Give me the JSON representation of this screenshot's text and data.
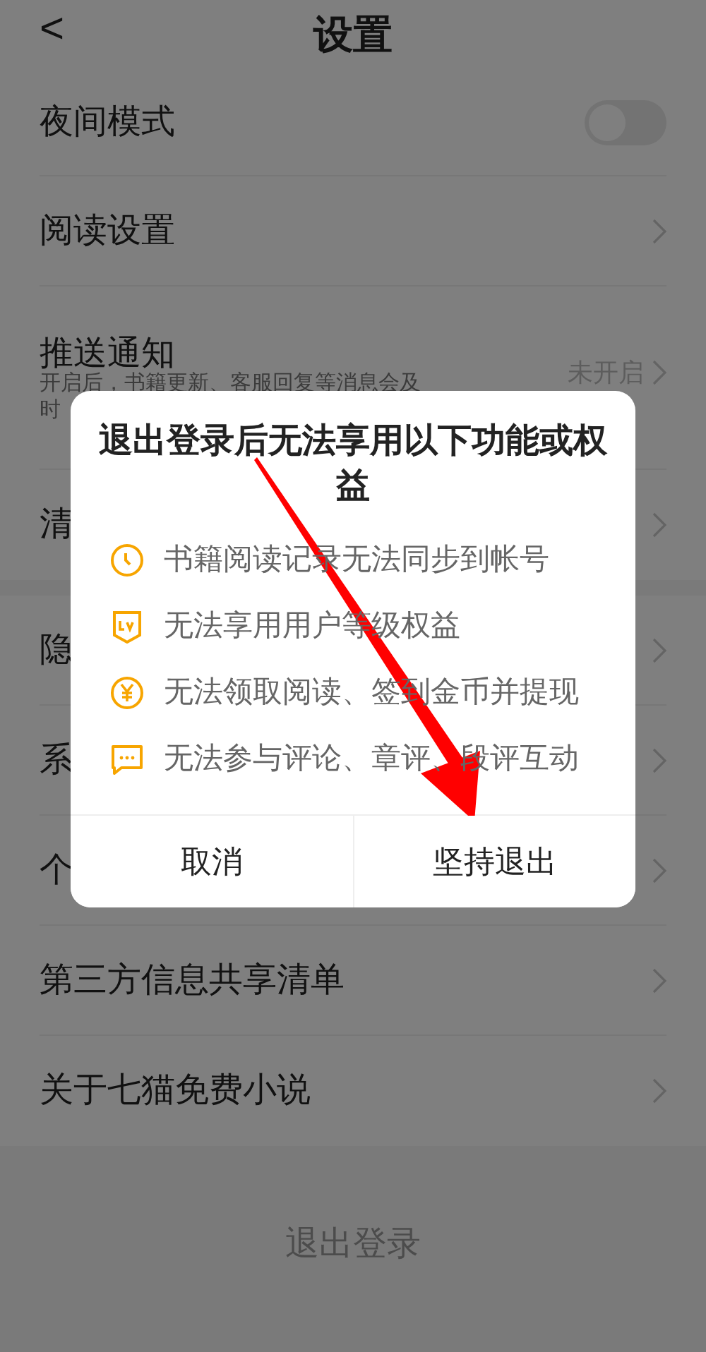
{
  "header": {
    "back": "<",
    "title": "设置"
  },
  "sections": [
    {
      "rows": [
        {
          "kind": "toggle",
          "label": "夜间模式",
          "on": false
        },
        {
          "kind": "link",
          "label": "阅读设置"
        },
        {
          "kind": "link",
          "label": "推送通知",
          "subtitle": [
            "开启后，书籍更新、客服回复等消息会及",
            "时"
          ],
          "value": "未开启"
        },
        {
          "kind": "link",
          "label": "清"
        }
      ]
    },
    {
      "rows": [
        {
          "kind": "link",
          "label": "隐"
        },
        {
          "kind": "link",
          "label": "系"
        },
        {
          "kind": "link",
          "label": "个"
        },
        {
          "kind": "link",
          "label": "第三方信息共享清单"
        },
        {
          "kind": "link",
          "label": "关于七猫免费小说"
        }
      ]
    }
  ],
  "logout": "退出登录",
  "dialog": {
    "title": "退出登录后无法享用以下功能或权益",
    "items": [
      {
        "kind": "clock",
        "text": "书籍阅读记录无法同步到帐号"
      },
      {
        "kind": "level",
        "text": "无法享用用户等级权益"
      },
      {
        "kind": "coin",
        "text": "无法领取阅读、签到金币并提现"
      },
      {
        "kind": "chat",
        "text": "无法参与评论、章评、段评互动"
      }
    ],
    "buttons": [
      "取消",
      "坚持退出"
    ]
  }
}
